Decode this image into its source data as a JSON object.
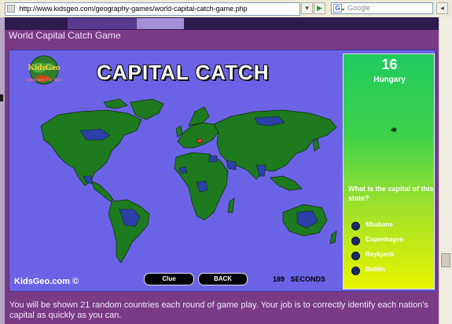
{
  "browser": {
    "url": "http://www.kidsgeo.com/geography-games/world-capital-catch-game.php",
    "search_placeholder": "Google",
    "go_glyph": "▶"
  },
  "page": {
    "title": "World Capital Catch Game",
    "footer": "You will be shown 21 random countries each round of game play. Your job is to correctly identify each nation's capital as quickly as you can."
  },
  "game": {
    "heading": "CAPITAL CATCH",
    "logo_text": "KidsGeo",
    "logo_tagline": "Geography For Kids",
    "site_label": "KidsGeo.com ©",
    "clue_label": "Clue",
    "back_label": "BACK",
    "seconds_value": "189",
    "seconds_unit": "SECONDS"
  },
  "panel": {
    "score": "16",
    "country": "Hungary",
    "question": "What is the capital of this state?",
    "options": [
      "Mbabane",
      "Copenhagen",
      "Reykjavik",
      "Dublin"
    ]
  },
  "colors": {
    "page_bg": "#7a3a86",
    "game_bg": "#6b63e6",
    "land": "#1e7a1e",
    "highlight_country": "#ff3333",
    "option_dot": "#1a2a66"
  }
}
